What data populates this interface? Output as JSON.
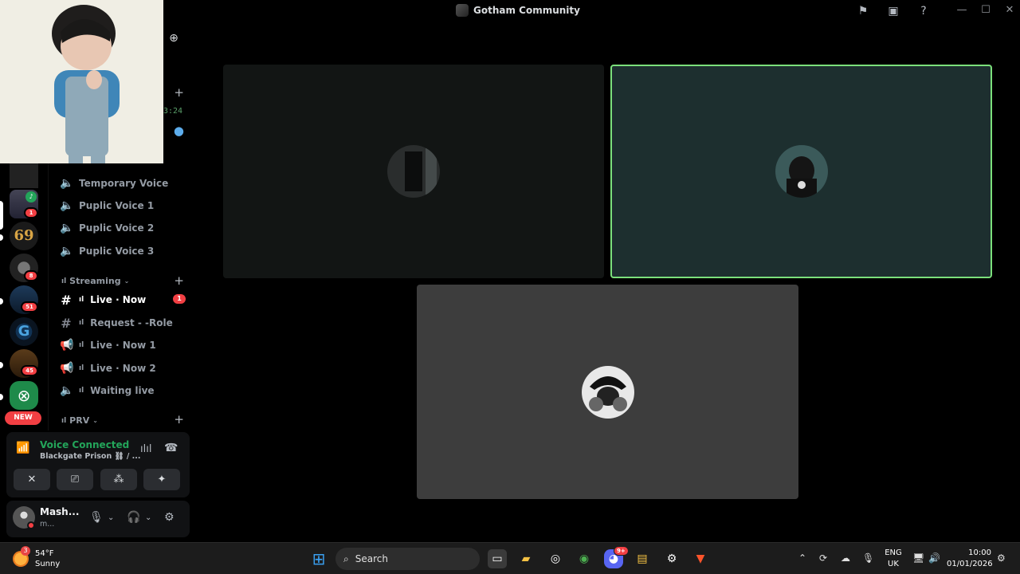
{
  "window": {
    "title": "Gotham Community",
    "controls": {
      "minimize": "—",
      "maximize": "☐",
      "close": "✕"
    },
    "icons": [
      "flag-icon",
      "inbox-icon",
      "help-icon"
    ]
  },
  "channel_sidebar": {
    "time_fragment": "3:24",
    "voice_channels_top": [
      {
        "name": "Temporary Voice",
        "icon": "speaker-icon"
      },
      {
        "name": "Puplic Voice 1",
        "icon": "speaker-icon"
      },
      {
        "name": "Puplic Voice 2",
        "icon": "speaker-icon"
      },
      {
        "name": "Puplic Voice 3",
        "icon": "speaker-icon"
      }
    ],
    "streaming_category": "Streaming",
    "streaming_channels": [
      {
        "name": "Live · Now",
        "icon": "hash-icon",
        "badge": "1",
        "active": true
      },
      {
        "name": "Request - -Role",
        "icon": "hash-icon"
      },
      {
        "name": "Live · Now 1",
        "icon": "stage-icon"
      },
      {
        "name": "Live · Now 2",
        "icon": "stage-icon"
      },
      {
        "name": "Waiting live",
        "icon": "speaker-icon"
      }
    ],
    "prv_category": "PRV"
  },
  "server_rail": {
    "badges": [
      "1",
      "8",
      "51",
      "45"
    ],
    "server_69_label": "69",
    "new_label": "NEW"
  },
  "voice_panel": {
    "status": "Voice Connected",
    "location": "Blackgate Prison ⛓ / ..."
  },
  "user": {
    "name": "Mash...",
    "status": "m..."
  },
  "taskbar": {
    "weather_temp": "54°F",
    "weather_desc": "Sunny",
    "weather_badge": "3",
    "search_label": "Search",
    "lang_top": "ENG",
    "lang_bottom": "UK",
    "time": "10:00",
    "date": "01/01/2026",
    "discord_badge": "9+"
  },
  "colors": {
    "accent_green": "#23a55a",
    "speaking_border": "#7be07b",
    "badge_red": "#f23f43"
  }
}
